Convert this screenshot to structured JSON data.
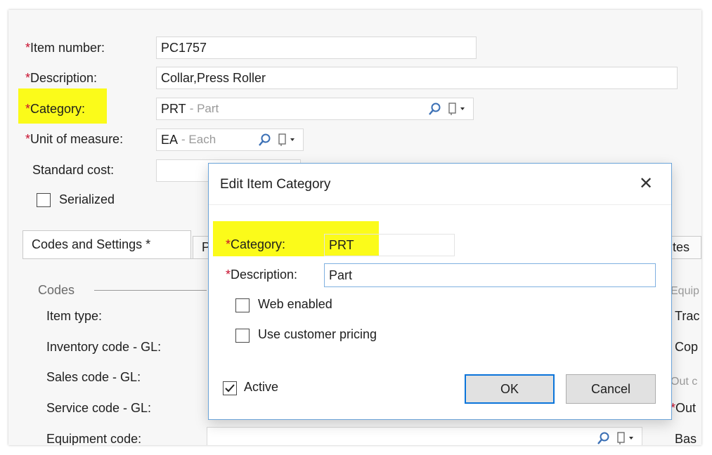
{
  "form": {
    "item_number": {
      "label": "Item number:",
      "value": "PC1757"
    },
    "description": {
      "label": "Description:",
      "value": "Collar,Press Roller"
    },
    "category": {
      "label": "Category:",
      "code": "PRT",
      "name": "- Part"
    },
    "unit_of_measure": {
      "label": "Unit of measure:",
      "code": "EA",
      "name": "- Each"
    },
    "standard_cost": {
      "label": "Standard cost:",
      "value": ""
    },
    "serialized_label": "Serialized",
    "required_marker": "*"
  },
  "tabs": [
    {
      "label": "Codes and Settings *"
    },
    {
      "label": "P"
    },
    {
      "label": "tes"
    }
  ],
  "codes": {
    "group_label": "Codes",
    "item_type": "Item type:",
    "inventory_code": "Inventory code - GL:",
    "sales_code": "Sales code - GL:",
    "service_code": "Service code - GL:",
    "equipment_code": "Equipment code:"
  },
  "right_partial": {
    "equip": "Equip",
    "trac": "Trac",
    "cop": "Cop",
    "out_c": "Out c",
    "out": "Out",
    "bas": "Bas",
    "req": "*"
  },
  "dialog": {
    "title": "Edit Item Category",
    "close_symbol": "✕",
    "category": {
      "label": "Category:",
      "value": "PRT"
    },
    "description": {
      "label": "Description:",
      "value": "Part"
    },
    "web_enabled": {
      "label": "Web enabled",
      "checked": false
    },
    "use_customer_pricing": {
      "label": "Use customer pricing",
      "checked": false
    },
    "active": {
      "label": "Active",
      "checked": true
    },
    "ok_label": "OK",
    "cancel_label": "Cancel"
  },
  "colors": {
    "highlight": "#fbfb1a",
    "required": "#c8102e",
    "dialog_border": "#6aa3d8",
    "ok_border": "#0a74da"
  },
  "icons": [
    "cursor-arrow-icon",
    "search-icon",
    "dropdown-menu-icon",
    "close-icon",
    "checkmark-icon"
  ]
}
